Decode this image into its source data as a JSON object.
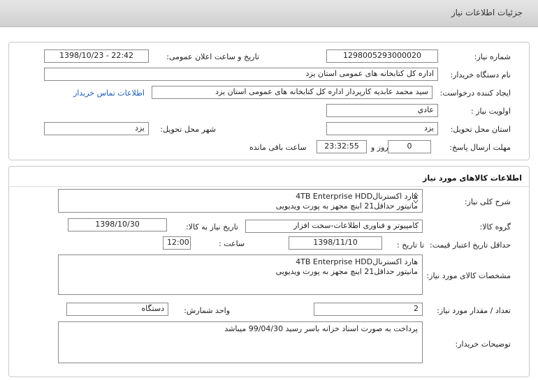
{
  "header": {
    "title": "جزئیات اطلاعات نیاز"
  },
  "info": {
    "need_number_label": "شماره نیاز:",
    "need_number": "1298005293000020",
    "announce_label": "تاریخ و ساعت اعلان عمومی:",
    "announce_value": "1398/10/23 - 22:42",
    "buyer_label": "نام دستگاه خریدار:",
    "buyer_value": "اداره کل کتابخانه های عمومی استان یزد",
    "creator_label": "ایجاد کننده درخواست:",
    "creator_value": "سید محمد عابدیه کارپرداز اداره کل کتابخانه های عمومی استان یزد",
    "contact_link": "اطلاعات تماس خریدار",
    "priority_label": "اولویت نیاز :",
    "priority_value": "عادي",
    "province_label": "استان محل تحویل:",
    "province_value": "یزد",
    "city_label": "شهر محل تحویل:",
    "city_value": "یزد",
    "deadline_label": "مهلت ارسال پاسخ:",
    "days_value": "0",
    "days_label": "روز و",
    "time_value": "23:32:55",
    "remaining_label": "ساعت باقی مانده"
  },
  "goods": {
    "section_title": "اطلاعات کالاهای مورد نیاز",
    "general_label": "شرح کلی نیاز:",
    "general_line1": "هارد اکسترنال4TB Enterprise HDD",
    "general_line2": "مانیتور حداقل21 اینچ مجهز به پورت ویدیویی",
    "group_label": "گروه کالا:",
    "group_value": "کامپیوتر و فناوری اطلاعات-سخت افزار",
    "need_date_label": "تاریخ نیاز به کالا:",
    "need_date_value": "1398/10/30",
    "validity_label": "حداقل تاریخ اعتبار قیمت:",
    "until_label": "تا تاریخ :",
    "validity_date": "1398/11/10",
    "hour_label": "ساعت :",
    "validity_time": "12:00",
    "spec_label": "مشخصات کالای مورد نیاز:",
    "spec_line1": "هارد اکسترنال4TB Enterprise HDD",
    "spec_line2": "مانیتور حداقل21 اینچ مجهز به پورت ویدیویی",
    "qty_label": "تعداد / مقدار مورد نیاز:",
    "qty_value": "2",
    "unit_label": "واحد شمارش:",
    "unit_value": "دستگاه",
    "desc_label": "توضیحات خریدار:",
    "desc_value": "پرداخت به صورت اسناد خزانه باسر رسید 99/04/30 میباشد"
  },
  "colors": {
    "link": "#1a5cb3",
    "border": "#8a8a8a",
    "header_bg": "#d8d8d8"
  }
}
